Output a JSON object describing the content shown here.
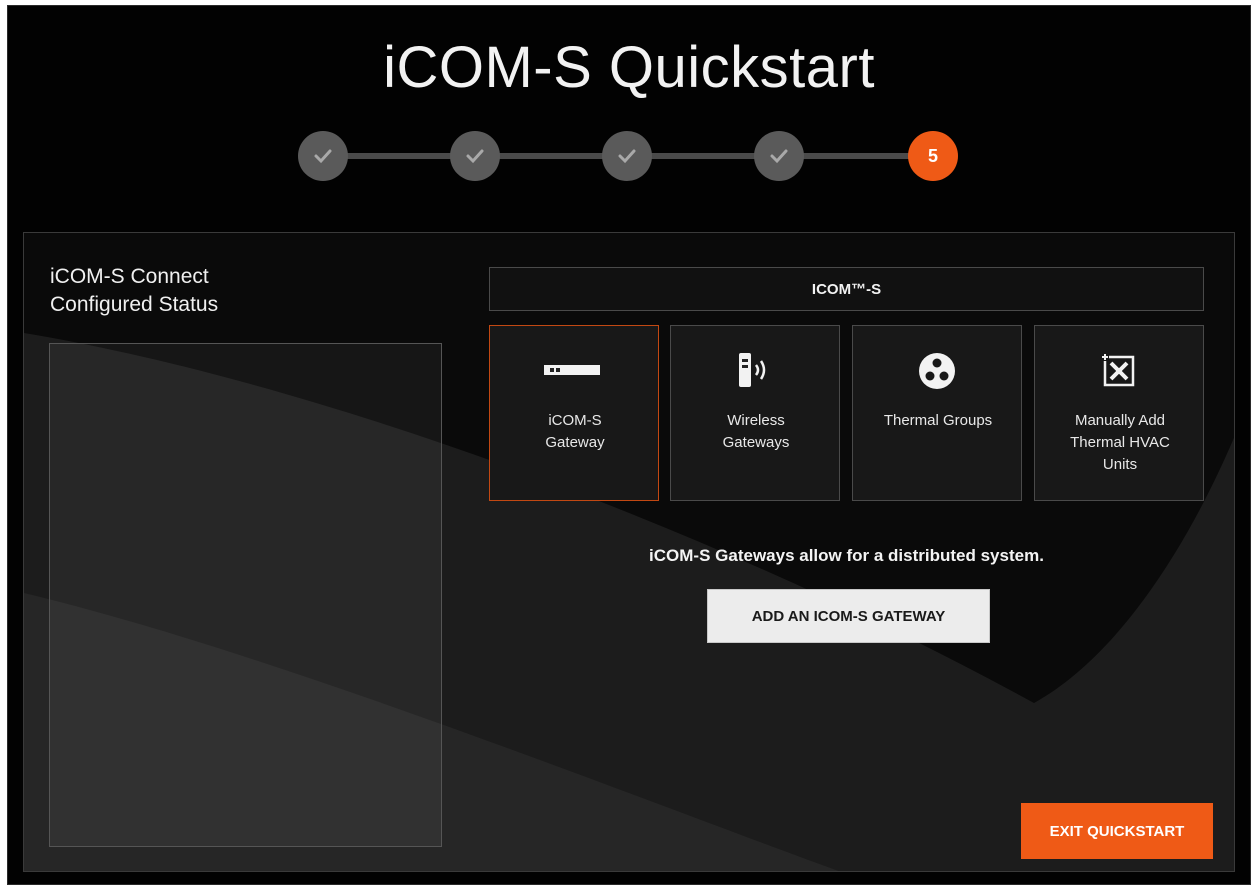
{
  "page": {
    "title": "iCOM-S Quickstart"
  },
  "stepper": {
    "steps": [
      {
        "state": "complete",
        "icon": "check-icon"
      },
      {
        "state": "complete",
        "icon": "check-icon"
      },
      {
        "state": "complete",
        "icon": "check-icon"
      },
      {
        "state": "complete",
        "icon": "check-icon"
      },
      {
        "state": "active",
        "label": "5"
      }
    ],
    "colors": {
      "complete": "#5a5a5a",
      "active": "#ef5a16"
    }
  },
  "left_panel": {
    "title_line1": "iCOM-S Connect",
    "title_line2": "Configured Status"
  },
  "main": {
    "section_header": "ICOM™-S",
    "cards": [
      {
        "label_line1": "iCOM-S",
        "label_line2": "Gateway",
        "label_line3": "",
        "icon": "gateway-device-icon",
        "selected": true
      },
      {
        "label_line1": "Wireless",
        "label_line2": "Gateways",
        "label_line3": "",
        "icon": "wireless-gateway-icon",
        "selected": false
      },
      {
        "label_line1": "Thermal Groups",
        "label_line2": "",
        "label_line3": "",
        "icon": "thermal-groups-icon",
        "selected": false
      },
      {
        "label_line1": "Manually Add",
        "label_line2": "Thermal HVAC",
        "label_line3": "Units",
        "icon": "manual-add-units-icon",
        "selected": false
      }
    ],
    "info_text": "iCOM-S Gateways allow for a distributed system.",
    "add_button": "ADD AN ICOM-S GATEWAY"
  },
  "footer": {
    "exit_button": "EXIT QUICKSTART"
  },
  "colors": {
    "accent": "#ef5a16",
    "background": "#020202"
  }
}
